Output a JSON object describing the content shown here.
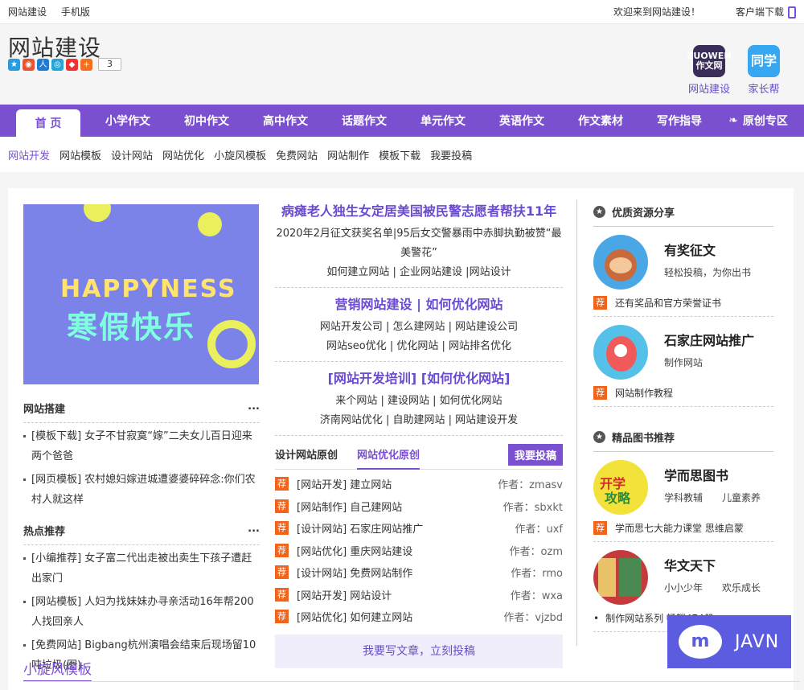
{
  "topbar": {
    "links": [
      "网站建设",
      "手机版"
    ],
    "welcome": "欢迎来到网站建设！",
    "client": "客户端下载"
  },
  "header": {
    "logo": "网站建设",
    "share_count": "3",
    "apps": [
      {
        "icon_text": "ZUOWEN\n作文网",
        "label": "网站建设",
        "color": "#3a2d58"
      },
      {
        "icon_text": "同学",
        "label": "家长帮",
        "color": "#36a7f0"
      }
    ]
  },
  "nav": [
    "首 页",
    "小学作文",
    "初中作文",
    "高中作文",
    "话题作文",
    "单元作文",
    "英语作文",
    "作文素材",
    "写作指导",
    "原创专区"
  ],
  "subnav": [
    "网站开发",
    "网站模板",
    "设计网站",
    "网站优化",
    "小旋风模板",
    "免费网站",
    "网站制作",
    "模板下载",
    "我要投稿"
  ],
  "banner": {
    "line1": "HAPPYNESS",
    "line2": "寒假快乐"
  },
  "left": {
    "sec1_title": "网站搭建",
    "sec1_items": [
      "[模板下载] 女子不甘寂寞“嫁”二夫女儿百日迎来两个爸爸",
      "[网页模板] 农村媳妇嫁进城遭婆婆碎碎念:你们农村人就这样"
    ],
    "sec2_title": "热点推荐",
    "sec2_items": [
      "[小编推荐] 女子富二代出走被出卖生下孩子遭赶出家门",
      "[网站模板] 人妇为找妹妹办寻亲活动16年帮200人找回亲人",
      "[免费网站] Bigbang杭州演唱会结束后现场留10吨垃圾(图)"
    ],
    "more": "..."
  },
  "center": {
    "blocks": [
      {
        "h": "病瘫老人独生女定居美国被民警志愿者帮扶11年",
        "p": [
          "2020年2月征文获奖名单|95后女交警暴雨中赤脚执勤被赞“最美警花”",
          "如何建立网站 | 企业网站建设 |网站设计"
        ]
      },
      {
        "h": "营销网站建设 | 如何优化网站",
        "p": [
          "网站开发公司 | 怎么建网站 | 网站建设公司",
          "网站seo优化 | 优化网站 | 网站排名优化"
        ]
      },
      {
        "h": "[网站开发培训] [如何优化网站]",
        "p": [
          "来个网站 | 建设网站 | 如何优化网站",
          "济南网站优化 | 自助建网站 | 网站建设开发"
        ]
      }
    ],
    "tabs": [
      "设计网站原创",
      "网站优化原创"
    ],
    "submit": "我要投稿",
    "tag": "荐",
    "articles": [
      {
        "t": "[网站开发] 建立网站",
        "a": "作者：zmasv"
      },
      {
        "t": "[网站制作] 自己建网站",
        "a": "作者：sbxkt"
      },
      {
        "t": "[设计网站] 石家庄网站推广",
        "a": "作者：uxf"
      },
      {
        "t": "[网站优化] 重庆网站建设",
        "a": "作者：ozm"
      },
      {
        "t": "[设计网站] 免费网站制作",
        "a": "作者：rmo"
      },
      {
        "t": "[网站开发] 网站设计",
        "a": "作者：wxa"
      },
      {
        "t": "[网站优化] 如何建立网站",
        "a": "作者：vjzbd"
      }
    ],
    "write": "我要写文章，立刻投稿"
  },
  "right": {
    "sec1": "优质资源分享",
    "res": [
      {
        "n": "有奖征文",
        "d": "轻松投稿，为你出书",
        "note": "还有奖品和官方荣誉证书"
      },
      {
        "n": "石家庄网站推广",
        "d": "制作网站",
        "note": "网站制作教程"
      }
    ],
    "sec2": "精品图书推荐",
    "books": [
      {
        "n": "学而思图书",
        "d": "学科教辅　　儿童素养",
        "note": "学而思七大能力课堂 思维启蒙"
      },
      {
        "n": "华文天下",
        "d": "小小少年　　欢乐成长",
        "note": "制作网站系列 畅销474册"
      }
    ],
    "tag": "荐"
  },
  "bottom_title": "小旋风模板",
  "badge": {
    "mark": "m",
    "text": "JAVN"
  }
}
